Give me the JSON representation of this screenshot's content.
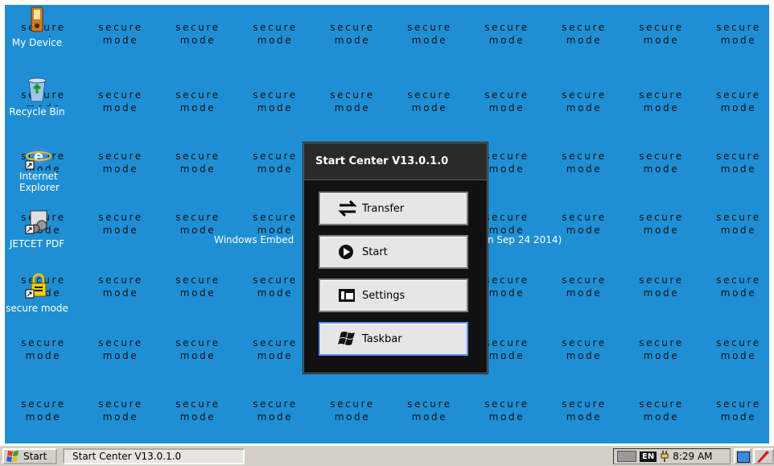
{
  "watermark": {
    "line1": "secure",
    "line2": "mode"
  },
  "desktop_icons": [
    {
      "label": "My Device",
      "icon": "device-icon"
    },
    {
      "label": "Recycle Bin",
      "icon": "recycle-bin-icon"
    },
    {
      "label": "Internet Explorer",
      "icon": "internet-explorer-icon"
    },
    {
      "label": "JETCET PDF",
      "icon": "pdf-icon"
    },
    {
      "label": "secure mode",
      "icon": "lock-icon"
    }
  ],
  "banner_left": "Windows Embed",
  "banner_right": "n Sep 24 2014)",
  "start_center": {
    "title": "Start Center V13.0.1.0",
    "buttons": [
      {
        "label": "Transfer",
        "icon": "transfer-icon"
      },
      {
        "label": "Start",
        "icon": "play-icon"
      },
      {
        "label": "Settings",
        "icon": "settings-icon"
      },
      {
        "label": "Taskbar",
        "icon": "windows-flag-icon"
      }
    ]
  },
  "taskbar": {
    "start_label": "Start",
    "task_label": "Start Center V13.0.1.0",
    "lang": "EN",
    "time": "8:29 AM"
  },
  "colors": {
    "desktop": "#1f8fd5",
    "selected_border": "#5f8ff0"
  }
}
